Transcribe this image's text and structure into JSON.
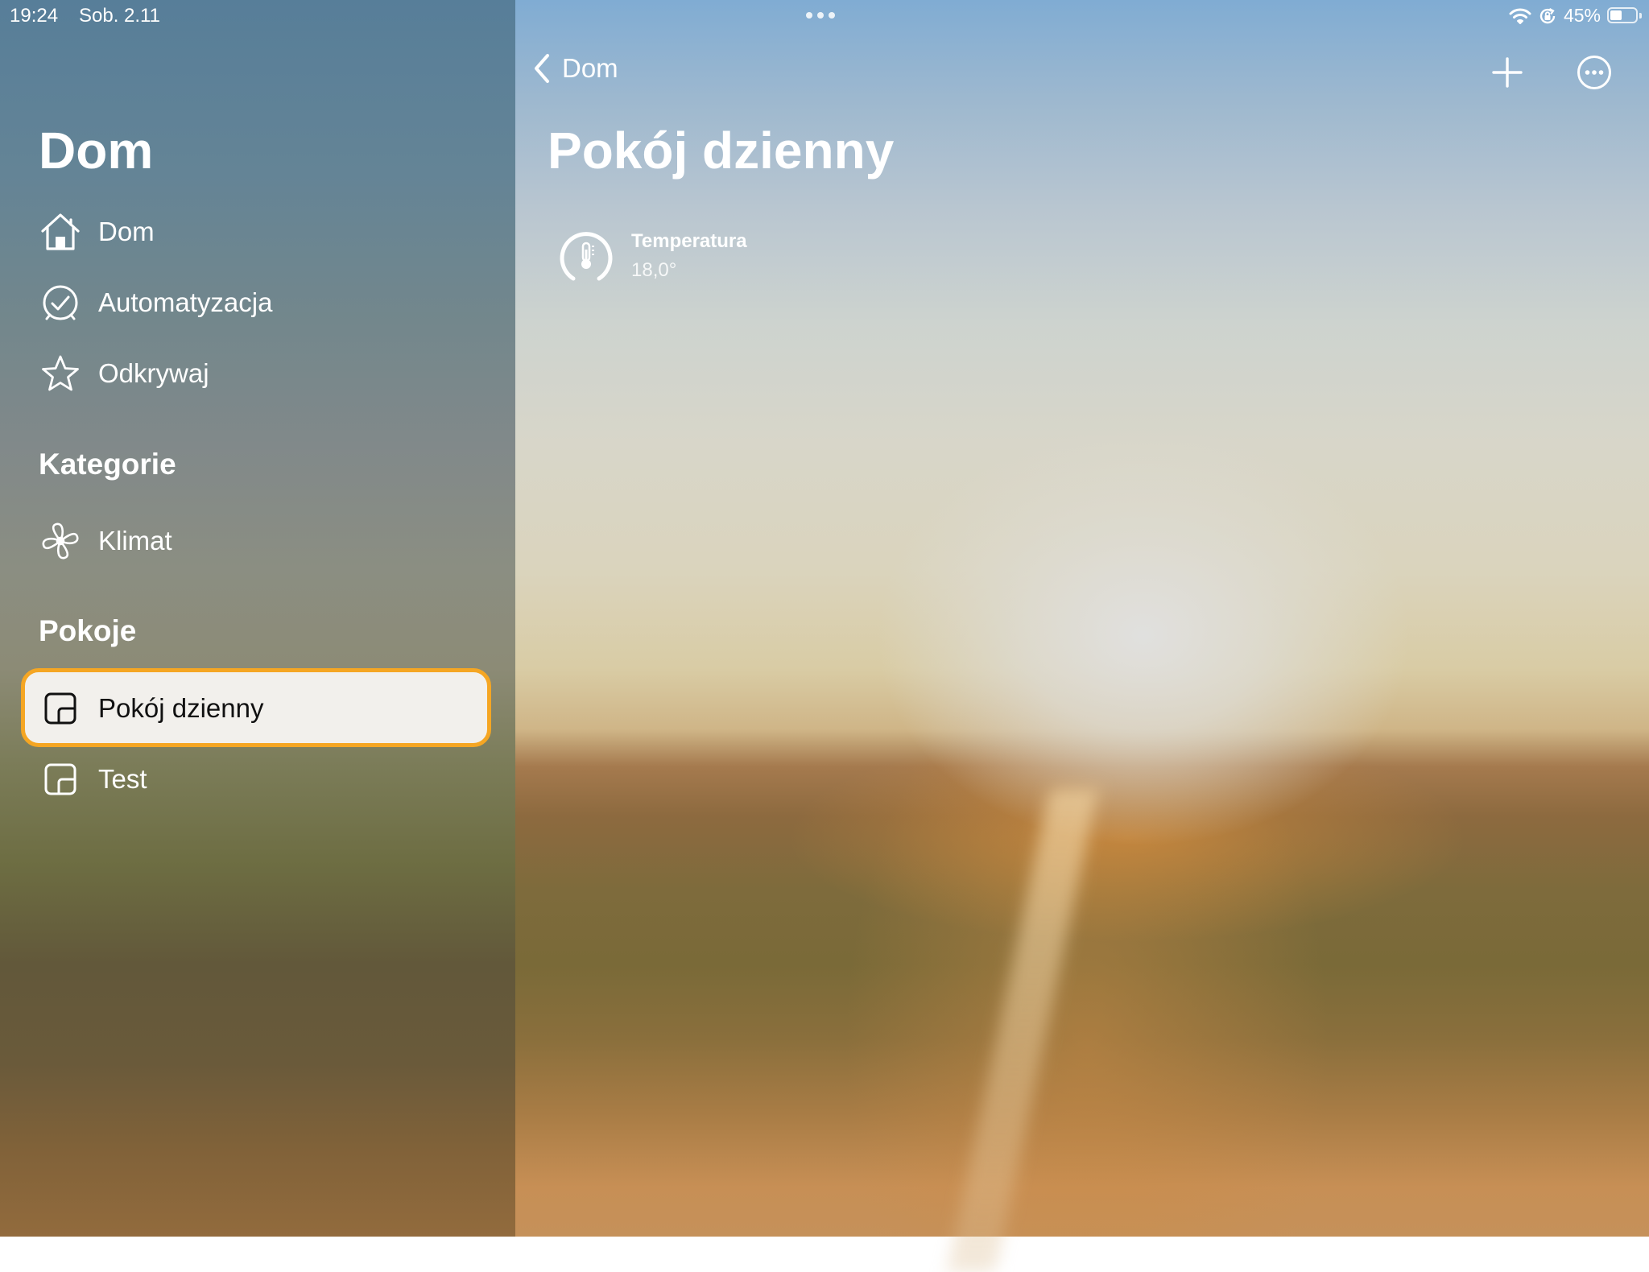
{
  "status_bar": {
    "time": "19:24",
    "date": "Sob. 2.11",
    "battery_percent": "45%",
    "battery_level": 0.45
  },
  "sidebar": {
    "title": "Dom",
    "nav": [
      {
        "label": "Dom",
        "icon": "house-icon"
      },
      {
        "label": "Automatyzacja",
        "icon": "clock-check-icon"
      },
      {
        "label": "Odkrywaj",
        "icon": "star-icon"
      }
    ],
    "categories_header": "Kategorie",
    "categories": [
      {
        "label": "Klimat",
        "icon": "fan-icon"
      }
    ],
    "rooms_header": "Pokoje",
    "rooms": [
      {
        "label": "Pokój dzienny",
        "icon": "room-icon",
        "selected": true
      },
      {
        "label": "Test",
        "icon": "room-icon",
        "selected": false
      }
    ]
  },
  "main": {
    "back_label": "Dom",
    "title": "Pokój dzienny",
    "tiles": [
      {
        "name": "Temperatura",
        "value": "18,0°",
        "icon": "thermometer-icon"
      }
    ]
  },
  "colors": {
    "selection_border": "#f5a623",
    "selection_bg": "#f2f0ec"
  }
}
